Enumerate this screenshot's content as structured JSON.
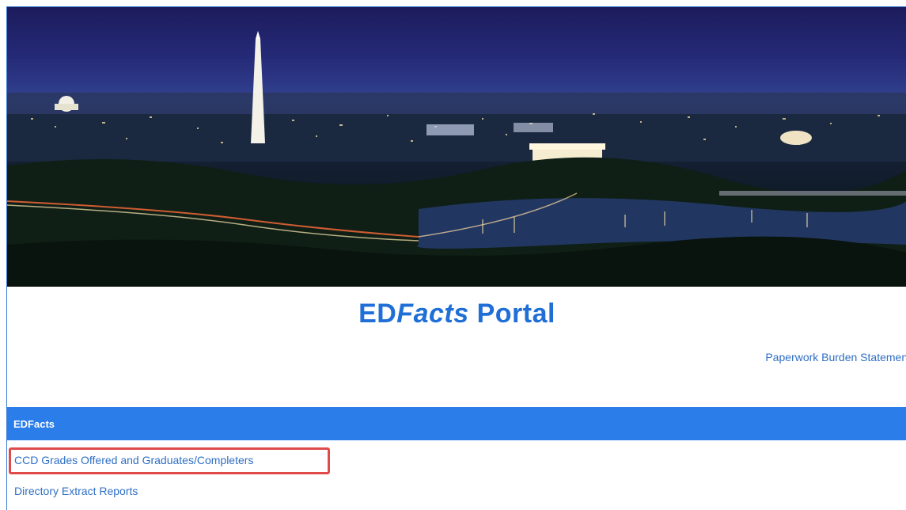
{
  "header": {
    "title_prefix": "ED",
    "title_italic": "Facts",
    "title_suffix": " Portal"
  },
  "links": {
    "paperwork": "Paperwork Burden Statement"
  },
  "section": {
    "label": "EDFacts",
    "items": [
      "CCD Grades Offered and Graduates/Completers",
      "Directory Extract Reports"
    ]
  },
  "colors": {
    "brand_blue": "#1f6fd6",
    "bar_blue": "#2b7de9",
    "link_blue": "#2f6fc4",
    "highlight_red": "#e04a4a"
  }
}
